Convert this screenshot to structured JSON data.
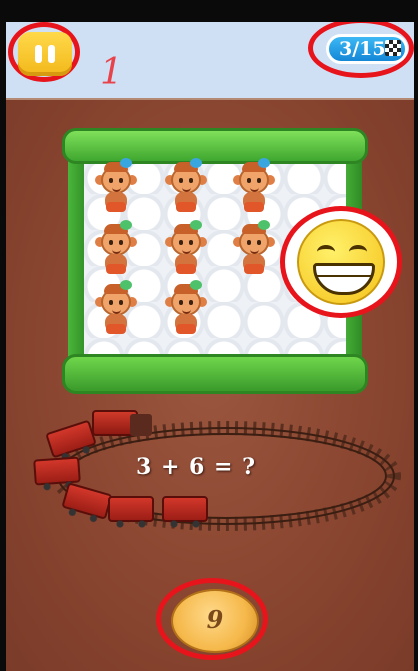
{
  "hud": {
    "level_number": "1",
    "progress": "3/15",
    "pause_icon": "pause-icon",
    "finish_flag_icon": "checkered-flag-icon"
  },
  "crib": {
    "monkeys": [
      {
        "bow": "blue"
      },
      {
        "bow": "blue"
      },
      {
        "bow": "blue"
      },
      {
        "bow": "green"
      },
      {
        "bow": "green"
      },
      {
        "bow": "green"
      },
      {
        "bow": "green"
      },
      {
        "bow": "green"
      }
    ]
  },
  "feedback": {
    "icon": "grinning-smiley-icon"
  },
  "question": {
    "text": "3 + 6 = ?"
  },
  "answer": {
    "value": "9"
  },
  "colors": {
    "annotation_ring": "#e8141c",
    "crib_green": "#3fa72f",
    "floor_brown": "#8b4a32",
    "train_red": "#c22a20"
  }
}
